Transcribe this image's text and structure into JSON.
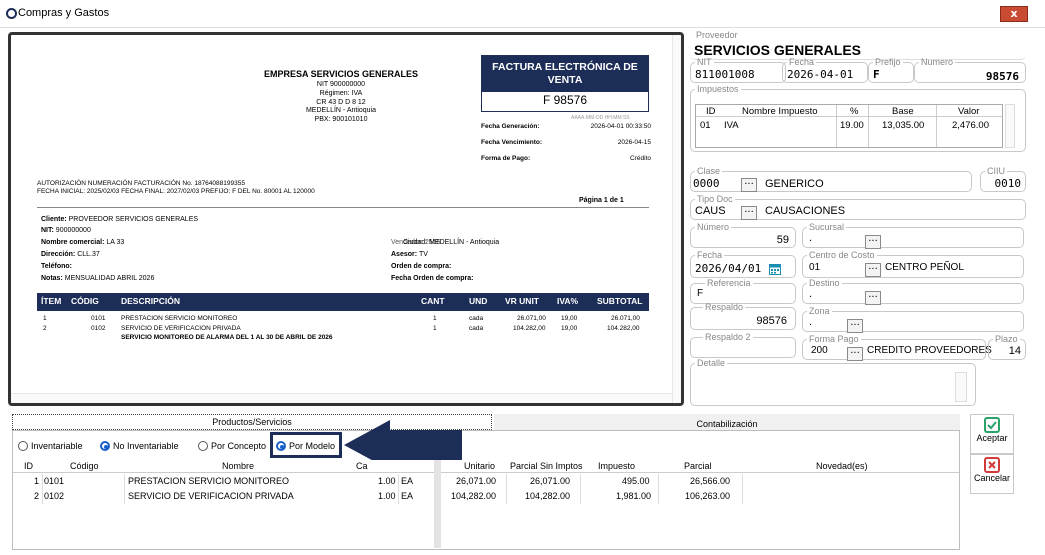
{
  "window": {
    "title": "Compras y Gastos",
    "close_label": "x"
  },
  "invoice": {
    "company_name": "EMPRESA SERVICIOS GENERALES",
    "company_lines": [
      "NIT 900000000",
      "Régimen: IVA",
      "CR 43 D D 8 12",
      "MEDELLÍN - Antioquia",
      "PBX: 900101010"
    ],
    "doc_title": "FACTURA ELECTRÓNICA DE VENTA",
    "doc_number": "F 98576",
    "tiny_text": "AAAA-MM-DD HH:MM:SS",
    "fecha_generacion_label": "Fecha Generación:",
    "fecha_generacion": "2026-04-01 00:33:50",
    "fecha_vencimiento_label": "Fecha Vencimiento:",
    "fecha_vencimiento": "2026-04-15",
    "forma_pago_label": "Forma de Pago:",
    "forma_pago": "Crédito",
    "auth_line1": "AUTORIZACIÓN NUMERACIÓN FACTURACIÓN No. 18764088199355",
    "auth_line2": "FECHA INICIAL: 2025/02/03 FECHA FINAL: 2027/02/03 PREFIJO: F DEL No. 80001 AL 120000",
    "pagina": "Página 1  de 1",
    "cliente_label": "Cliente:",
    "cliente": "PROVEEDOR SERVICIOS GENERALES",
    "nit_label": "NIT:",
    "nit": "900000000",
    "nombre_comercial_label": "Nombre comercial:",
    "nombre_comercial": "LA 33",
    "direccion_label": "Dirección:",
    "direccion": "CLL.37",
    "telefono_label": "Teléfono:",
    "notas_label": "Notas:",
    "notas": "MENSUALIDAD ABRIL 2026",
    "ciudad_overlap": "Ciudad: MEDELLÍN - Antioquia",
    "ciudad_ghost": "Vendedor: 2556",
    "asesor_label": "Asesor:",
    "asesor": "TV",
    "orden_compra_label": "Orden de compra:",
    "fecha_orden_label": "Fecha Orden de compra:",
    "items_headers": [
      "ÍTEM",
      "CÓDIG",
      "DESCRIPCIÓN",
      "CANT",
      "UND",
      "VR UNIT",
      "IVA%",
      "SUBTOTAL"
    ],
    "items": [
      {
        "item": "1",
        "codigo": "0101",
        "descripcion": "PRESTACION SERVICIO MONITOREO",
        "cant": "1",
        "und": "cada",
        "vr_unit": "26.071,00",
        "iva": "19,00",
        "subtotal": "26.071,00"
      },
      {
        "item": "2",
        "codigo": "0102",
        "descripcion": "SERVICIO DE VERIFICACION PRIVADA",
        "cant": "1",
        "und": "cada",
        "vr_unit": "104.282,00",
        "iva": "19,00",
        "subtotal": "104.282,00"
      }
    ],
    "items_note": "SERVICIO MONITOREO DE ALARMA DEL 1 AL 30 DE ABRIL DE 2026"
  },
  "form": {
    "proveedor_label": "Proveedor",
    "proveedor": "SERVICIOS GENERALES",
    "nit_label": "NIT",
    "nit": "811001008",
    "fecha_label": "Fecha",
    "fecha": "2026-04-01",
    "prefijo_label": "Prefijo",
    "prefijo": "F",
    "numero_label": "Numero",
    "numero": "98576",
    "impuestos_label": "Impuestos",
    "impuestos_headers": [
      "ID",
      "Nombre Impuesto",
      "%",
      "Base",
      "Valor"
    ],
    "impuestos_rows": [
      {
        "id": "01",
        "nombre": "IVA",
        "pct": "19.00",
        "base": "13,035.00",
        "valor": "2,476.00"
      }
    ],
    "clase_label": "Clase",
    "clase_code": "0000",
    "clase_name": "GENERICO",
    "ciiu_label": "CIIU",
    "ciiu": "0010",
    "tipo_doc_label": "Tipo Doc",
    "tipo_doc_code": "CAUS",
    "tipo_doc_name": "CAUSACIONES",
    "numero2_label": "Número",
    "numero2": "59",
    "sucursal_label": "Sucursal",
    "sucursal": ".",
    "fecha2_label": "Fecha",
    "fecha2": "2026/04/01",
    "centro_costo_label": "Centro de Costo",
    "centro_costo_code": "01",
    "centro_costo_name": "CENTRO PEÑOL",
    "referencia_label": "Referencia",
    "referencia": "F",
    "destino_label": "Destino",
    "destino": ".",
    "respaldo_label": "Respaldo",
    "respaldo": "98576",
    "zona_label": "Zona",
    "zona": ".",
    "respaldo2_label": "Respaldo 2",
    "forma_pago_label": "Forma Pago",
    "forma_pago_code": "200",
    "forma_pago_name": "CREDITO PROVEEDORES",
    "plazo_label": "Plazo",
    "plazo": "14",
    "detalle_label": "Detalle",
    "dots": "..."
  },
  "tabs": {
    "productos": "Productos/Servicios",
    "contabilizacion": "Contabilización"
  },
  "radios": [
    "Inventariable",
    "No Inventariable",
    "Por Concepto",
    "Por Modelo"
  ],
  "grid": {
    "headers": [
      "ID",
      "Código",
      "Nombre",
      "Ca",
      "Unitario",
      "Parcial Sin Imptos",
      "Impuesto",
      "Parcial",
      "Novedad(es)"
    ],
    "rows": [
      {
        "id": "1",
        "codigo": "0101",
        "nombre": "PRESTACION SERVICIO MONITOREO",
        "cant": "1.00",
        "und": "EA",
        "unitario": "26,071.00",
        "parcial_sin": "26,071.00",
        "impuesto": "495.00",
        "parcial": "26,566.00"
      },
      {
        "id": "2",
        "codigo": "0102",
        "nombre": "SERVICIO DE VERIFICACION PRIVADA",
        "cant": "1.00",
        "und": "EA",
        "unitario": "104,282.00",
        "parcial_sin": "104,282.00",
        "impuesto": "1,981.00",
        "parcial": "106,263.00"
      }
    ]
  },
  "buttons": {
    "aceptar": "Aceptar",
    "cancelar": "Cancelar"
  },
  "colors": {
    "navy": "#1c2d57",
    "accent_blue": "#1a5ec8",
    "ok_green": "#2aa36b",
    "cancel_red": "#d23a3a"
  }
}
